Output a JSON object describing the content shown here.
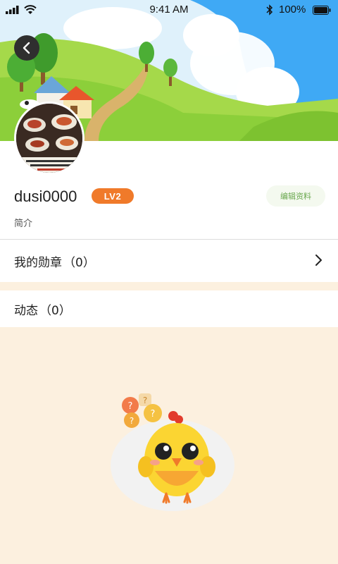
{
  "status_bar": {
    "time": "9:41 AM",
    "battery": "100%"
  },
  "profile": {
    "username": "dusi0000",
    "level": "LV2",
    "edit_label": "编辑资料",
    "bio_label": "简介"
  },
  "medals": {
    "label": "我的勋章",
    "count": "（0）"
  },
  "feed": {
    "label": "动态",
    "count": "（0）"
  },
  "icons": {
    "back": "back-arrow-icon",
    "chevron": "chevron-right-icon"
  },
  "colors": {
    "level_badge": "#f07a2a",
    "edit_text": "#6aa84f",
    "empty_bg": "#fcf0df",
    "sky": "#3fa9f5",
    "grass": "#8ccf3a"
  }
}
